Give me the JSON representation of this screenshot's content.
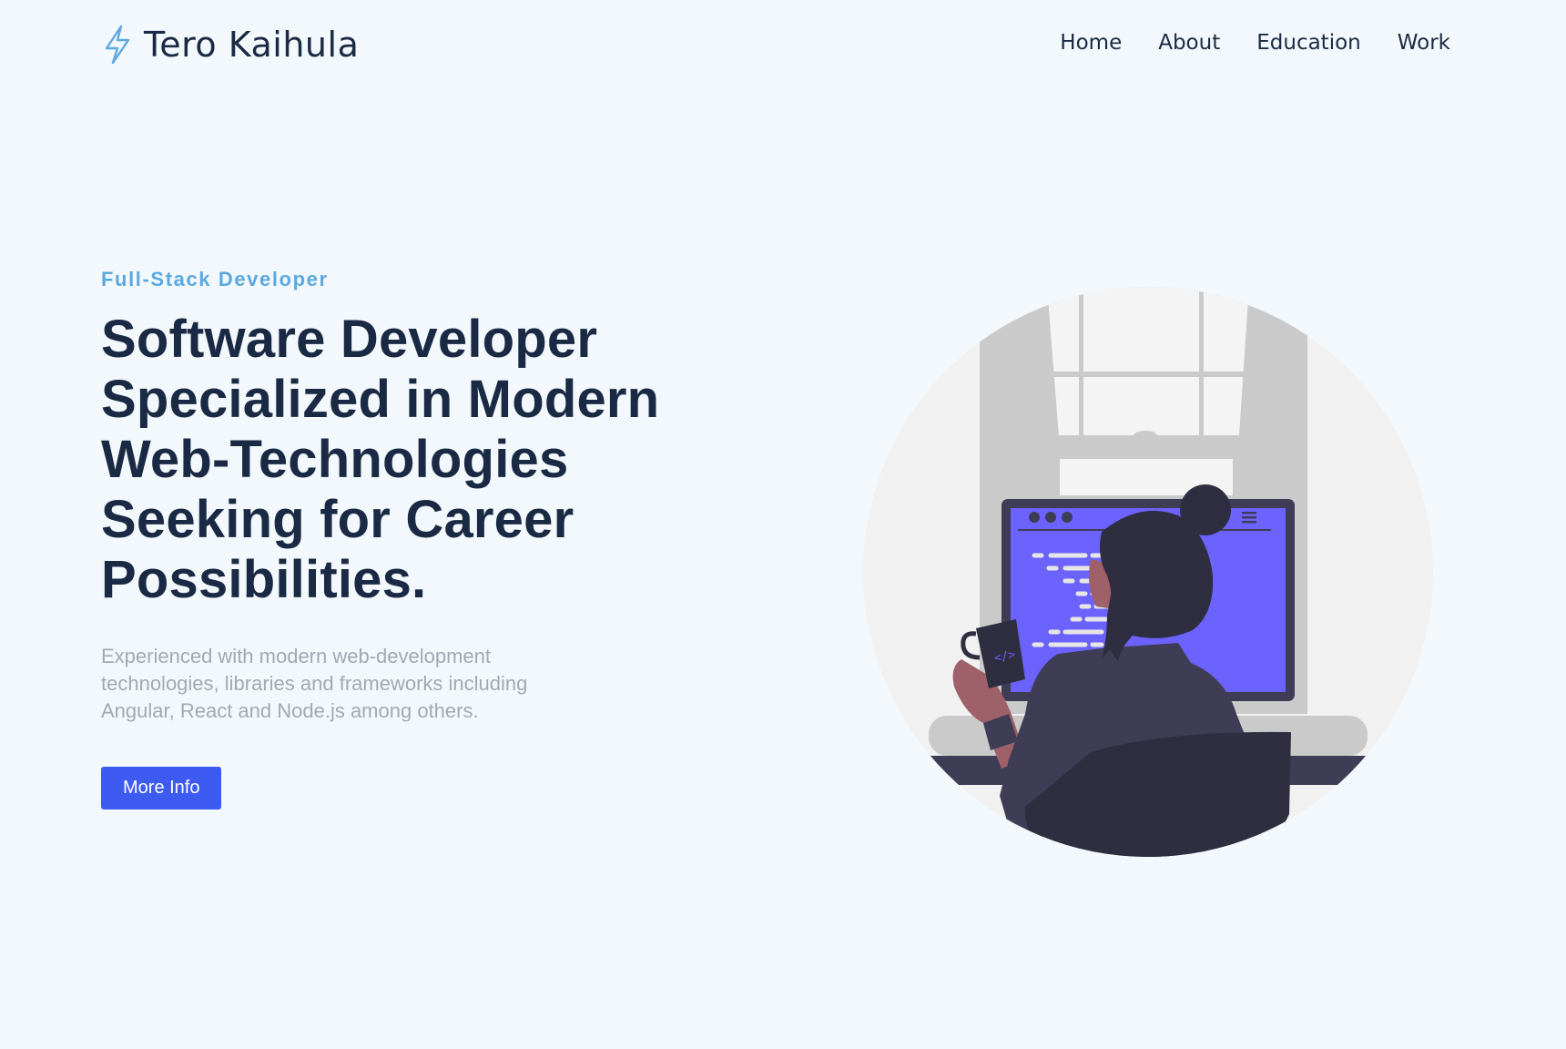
{
  "header": {
    "brand_name": "Tero Kaihula",
    "brand_icon": "lightning-bolt-icon",
    "nav": [
      {
        "label": "Home"
      },
      {
        "label": "About"
      },
      {
        "label": "Education"
      },
      {
        "label": "Work"
      }
    ]
  },
  "hero": {
    "eyebrow": "Full-Stack Developer",
    "headline_lines": [
      "Software Developer",
      "Specialized in Modern",
      "Web-Technologies",
      "Seeking for Career",
      "Possibilities."
    ],
    "description": "Experienced with modern web-development technologies, libraries and frameworks including Angular, React and Node.js among others.",
    "cta_label": "More Info"
  },
  "illustration": {
    "name": "developer-at-computer-illustration",
    "mug_label": "</>"
  },
  "colors": {
    "background": "#f2f8fc",
    "text_dark": "#1b2a44",
    "accent_blue": "#5ca9e0",
    "button": "#3d5af1",
    "screen": "#6c63ff",
    "muted_text": "#a3a9b3"
  }
}
